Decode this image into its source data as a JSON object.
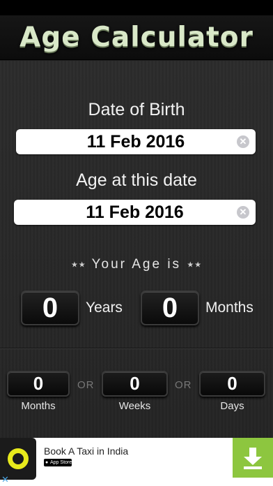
{
  "app": {
    "title": "Age Calculator"
  },
  "date_of_birth": {
    "label": "Date of Birth",
    "value": "11 Feb 2016"
  },
  "age_at_date": {
    "label": "Age at this date",
    "value": "11 Feb 2016"
  },
  "result": {
    "heading": "Your Age is",
    "years_value": "0",
    "years_label": "Years",
    "months_value": "0",
    "months_label": "Months"
  },
  "breakdown": {
    "months_value": "0",
    "months_label": "Months",
    "weeks_value": "0",
    "weeks_label": "Weeks",
    "days_value": "0",
    "days_label": "Days",
    "or_label": "OR"
  },
  "ad": {
    "text": "Book A Taxi in India",
    "store_badge": "App Store",
    "colors": {
      "logo_ring": "#e8ea1c",
      "download": "#8dc63f"
    }
  },
  "icons": [
    "clear-icon",
    "star-icon",
    "download-icon",
    "ad-close-icon",
    "app-store-icon"
  ]
}
